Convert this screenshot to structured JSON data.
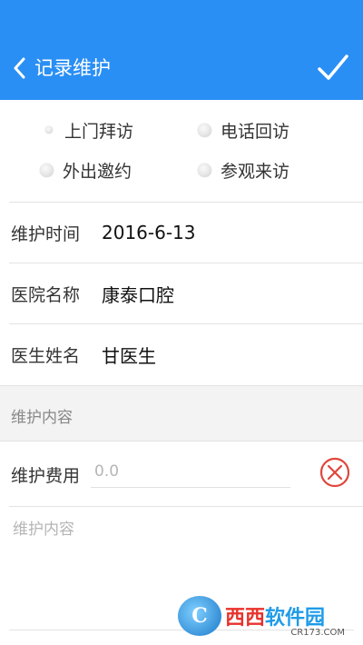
{
  "header": {
    "title": "记录维护",
    "back_icon": "chevron-left-icon",
    "confirm_icon": "checkmark-icon",
    "background_color": "#2a8ff4"
  },
  "visit_types": [
    {
      "label": "上门拜访",
      "selected": true
    },
    {
      "label": "电话回访",
      "selected": false
    },
    {
      "label": "外出邀约",
      "selected": false
    },
    {
      "label": "参观来访",
      "selected": false
    }
  ],
  "fields": {
    "time": {
      "label": "维护时间",
      "value": "2016-6-13"
    },
    "hospital": {
      "label": "医院名称",
      "value": "康泰口腔"
    },
    "doctor": {
      "label": "医生姓名",
      "value": "甘医生"
    }
  },
  "section": {
    "title": "维护内容"
  },
  "fee": {
    "label": "维护费用",
    "placeholder": "0.0",
    "clear_icon": "clear-circle-x-icon",
    "clear_color": "#e0463c"
  },
  "content": {
    "placeholder": "维护内容"
  },
  "watermark": {
    "logo_letter": "C",
    "brand_red": "西西",
    "brand_blue": "软件园",
    "site": "CR173.COM"
  }
}
